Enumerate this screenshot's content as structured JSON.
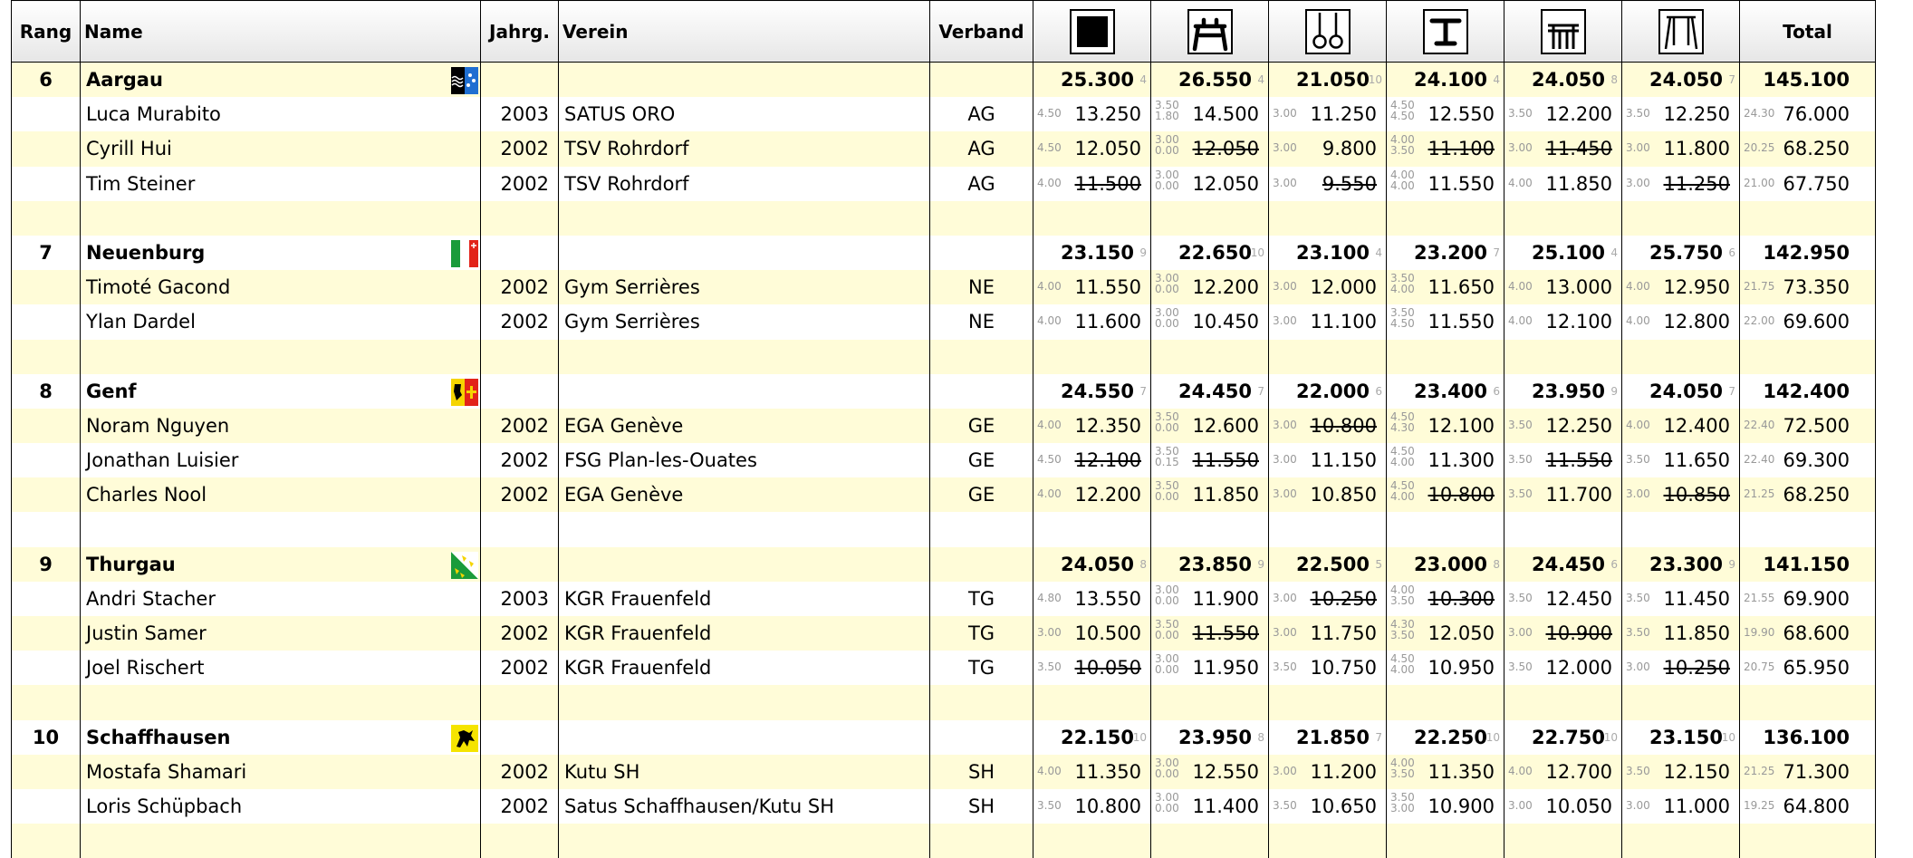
{
  "headers": {
    "rank": "Rang",
    "name": "Name",
    "year": "Jahrg.",
    "club": "Verein",
    "fed": "Verband",
    "total": "Total",
    "apparatus_icons": [
      "floor-icon",
      "pommel-horse-icon",
      "rings-icon",
      "vault-icon",
      "parallel-bars-icon",
      "high-bar-icon"
    ]
  },
  "rows": [
    {
      "kind": "team",
      "rank": "6",
      "name": "Aargau",
      "flag": "aargau-flag",
      "scores": [
        [
          "25.300",
          "4"
        ],
        [
          "26.550",
          "4"
        ],
        [
          "21.050",
          "10"
        ],
        [
          "24.100",
          "4"
        ],
        [
          "24.050",
          "8"
        ],
        [
          "24.050",
          "7"
        ]
      ],
      "total": "145.100"
    },
    {
      "kind": "athlete",
      "name": "Luca Murabito",
      "year": "2003",
      "club": "SATUS ORO",
      "fed": "AG",
      "scores": [
        {
          "d": [
            "4.50"
          ],
          "s": "13.250",
          "x": false
        },
        {
          "d": [
            "3.50",
            "1.80"
          ],
          "s": "14.500",
          "x": false
        },
        {
          "d": [
            "3.00"
          ],
          "s": "11.250",
          "x": false
        },
        {
          "d": [
            "4.50",
            "4.50"
          ],
          "s": "12.550",
          "x": false
        },
        {
          "d": [
            "3.50"
          ],
          "s": "12.200",
          "x": false
        },
        {
          "d": [
            "3.50"
          ],
          "s": "12.250",
          "x": false
        }
      ],
      "td": "24.30",
      "total": "76.000"
    },
    {
      "kind": "athlete",
      "name": "Cyrill Hui",
      "year": "2002",
      "club": "TSV Rohrdorf",
      "fed": "AG",
      "scores": [
        {
          "d": [
            "4.50"
          ],
          "s": "12.050",
          "x": false
        },
        {
          "d": [
            "3.00",
            "0.00"
          ],
          "s": "12.050",
          "x": true
        },
        {
          "d": [
            "3.00"
          ],
          "s": "9.800",
          "x": false
        },
        {
          "d": [
            "4.00",
            "3.50"
          ],
          "s": "11.100",
          "x": true
        },
        {
          "d": [
            "3.00"
          ],
          "s": "11.450",
          "x": true
        },
        {
          "d": [
            "3.00"
          ],
          "s": "11.800",
          "x": false
        }
      ],
      "td": "20.25",
      "total": "68.250"
    },
    {
      "kind": "athlete",
      "name": "Tim Steiner",
      "year": "2002",
      "club": "TSV Rohrdorf",
      "fed": "AG",
      "scores": [
        {
          "d": [
            "4.00"
          ],
          "s": "11.500",
          "x": true
        },
        {
          "d": [
            "3.00",
            "0.00"
          ],
          "s": "12.050",
          "x": false
        },
        {
          "d": [
            "3.00"
          ],
          "s": "9.550",
          "x": true
        },
        {
          "d": [
            "4.00",
            "4.00"
          ],
          "s": "11.550",
          "x": false
        },
        {
          "d": [
            "4.00"
          ],
          "s": "11.850",
          "x": false
        },
        {
          "d": [
            "3.00"
          ],
          "s": "11.250",
          "x": true
        }
      ],
      "td": "21.00",
      "total": "67.750"
    },
    {
      "kind": "spacer"
    },
    {
      "kind": "team",
      "rank": "7",
      "name": "Neuenburg",
      "flag": "neuchatel-flag",
      "scores": [
        [
          "23.150",
          "9"
        ],
        [
          "22.650",
          "10"
        ],
        [
          "23.100",
          "4"
        ],
        [
          "23.200",
          "7"
        ],
        [
          "25.100",
          "4"
        ],
        [
          "25.750",
          "6"
        ]
      ],
      "total": "142.950"
    },
    {
      "kind": "athlete",
      "name": "Timoté Gacond",
      "year": "2002",
      "club": "Gym Serrières",
      "fed": "NE",
      "scores": [
        {
          "d": [
            "4.00"
          ],
          "s": "11.550",
          "x": false
        },
        {
          "d": [
            "3.00",
            "0.00"
          ],
          "s": "12.200",
          "x": false
        },
        {
          "d": [
            "3.00"
          ],
          "s": "12.000",
          "x": false
        },
        {
          "d": [
            "3.50",
            "4.00"
          ],
          "s": "11.650",
          "x": false
        },
        {
          "d": [
            "4.00"
          ],
          "s": "13.000",
          "x": false
        },
        {
          "d": [
            "4.00"
          ],
          "s": "12.950",
          "x": false
        }
      ],
      "td": "21.75",
      "total": "73.350"
    },
    {
      "kind": "athlete",
      "name": "Ylan Dardel",
      "year": "2002",
      "club": "Gym Serrières",
      "fed": "NE",
      "scores": [
        {
          "d": [
            "4.00"
          ],
          "s": "11.600",
          "x": false
        },
        {
          "d": [
            "3.00",
            "0.00"
          ],
          "s": "10.450",
          "x": false
        },
        {
          "d": [
            "3.00"
          ],
          "s": "11.100",
          "x": false
        },
        {
          "d": [
            "3.50",
            "4.50"
          ],
          "s": "11.550",
          "x": false
        },
        {
          "d": [
            "4.00"
          ],
          "s": "12.100",
          "x": false
        },
        {
          "d": [
            "4.00"
          ],
          "s": "12.800",
          "x": false
        }
      ],
      "td": "22.00",
      "total": "69.600"
    },
    {
      "kind": "spacer"
    },
    {
      "kind": "team",
      "rank": "8",
      "name": "Genf",
      "flag": "geneva-flag",
      "scores": [
        [
          "24.550",
          "7"
        ],
        [
          "24.450",
          "7"
        ],
        [
          "22.000",
          "6"
        ],
        [
          "23.400",
          "6"
        ],
        [
          "23.950",
          "9"
        ],
        [
          "24.050",
          "7"
        ]
      ],
      "total": "142.400"
    },
    {
      "kind": "athlete",
      "name": "Noram Nguyen",
      "year": "2002",
      "club": "EGA Genève",
      "fed": "GE",
      "scores": [
        {
          "d": [
            "4.00"
          ],
          "s": "12.350",
          "x": false
        },
        {
          "d": [
            "3.50",
            "0.00"
          ],
          "s": "12.600",
          "x": false
        },
        {
          "d": [
            "3.00"
          ],
          "s": "10.800",
          "x": true
        },
        {
          "d": [
            "4.50",
            "4.30"
          ],
          "s": "12.100",
          "x": false
        },
        {
          "d": [
            "3.50"
          ],
          "s": "12.250",
          "x": false
        },
        {
          "d": [
            "4.00"
          ],
          "s": "12.400",
          "x": false
        }
      ],
      "td": "22.40",
      "total": "72.500"
    },
    {
      "kind": "athlete",
      "name": "Jonathan Luisier",
      "year": "2002",
      "club": "FSG Plan-les-Ouates",
      "fed": "GE",
      "scores": [
        {
          "d": [
            "4.50"
          ],
          "s": "12.100",
          "x": true
        },
        {
          "d": [
            "3.50",
            "0.15"
          ],
          "s": "11.550",
          "x": true
        },
        {
          "d": [
            "3.00"
          ],
          "s": "11.150",
          "x": false
        },
        {
          "d": [
            "4.50",
            "4.00"
          ],
          "s": "11.300",
          "x": false
        },
        {
          "d": [
            "3.50"
          ],
          "s": "11.550",
          "x": true
        },
        {
          "d": [
            "3.50"
          ],
          "s": "11.650",
          "x": false
        }
      ],
      "td": "22.40",
      "total": "69.300"
    },
    {
      "kind": "athlete",
      "name": "Charles Nool",
      "year": "2002",
      "club": "EGA Genève",
      "fed": "GE",
      "scores": [
        {
          "d": [
            "4.00"
          ],
          "s": "12.200",
          "x": false
        },
        {
          "d": [
            "3.50",
            "0.00"
          ],
          "s": "11.850",
          "x": false
        },
        {
          "d": [
            "3.00"
          ],
          "s": "10.850",
          "x": false
        },
        {
          "d": [
            "4.50",
            "4.00"
          ],
          "s": "10.800",
          "x": true
        },
        {
          "d": [
            "3.50"
          ],
          "s": "11.700",
          "x": false
        },
        {
          "d": [
            "3.00"
          ],
          "s": "10.850",
          "x": true
        }
      ],
      "td": "21.25",
      "total": "68.250"
    },
    {
      "kind": "spacer"
    },
    {
      "kind": "team",
      "rank": "9",
      "name": "Thurgau",
      "flag": "thurgau-flag",
      "scores": [
        [
          "24.050",
          "8"
        ],
        [
          "23.850",
          "9"
        ],
        [
          "22.500",
          "5"
        ],
        [
          "23.000",
          "8"
        ],
        [
          "24.450",
          "6"
        ],
        [
          "23.300",
          "9"
        ]
      ],
      "total": "141.150"
    },
    {
      "kind": "athlete",
      "name": "Andri Stacher",
      "year": "2003",
      "club": "KGR Frauenfeld",
      "fed": "TG",
      "scores": [
        {
          "d": [
            "4.80"
          ],
          "s": "13.550",
          "x": false
        },
        {
          "d": [
            "3.00",
            "0.00"
          ],
          "s": "11.900",
          "x": false
        },
        {
          "d": [
            "3.00"
          ],
          "s": "10.250",
          "x": true
        },
        {
          "d": [
            "4.00",
            "3.50"
          ],
          "s": "10.300",
          "x": true
        },
        {
          "d": [
            "3.50"
          ],
          "s": "12.450",
          "x": false
        },
        {
          "d": [
            "3.50"
          ],
          "s": "11.450",
          "x": false
        }
      ],
      "td": "21.55",
      "total": "69.900"
    },
    {
      "kind": "athlete",
      "name": "Justin Samer",
      "year": "2002",
      "club": "KGR Frauenfeld",
      "fed": "TG",
      "scores": [
        {
          "d": [
            "3.00"
          ],
          "s": "10.500",
          "x": false
        },
        {
          "d": [
            "3.50",
            "0.00"
          ],
          "s": "11.550",
          "x": true
        },
        {
          "d": [
            "3.00"
          ],
          "s": "11.750",
          "x": false
        },
        {
          "d": [
            "4.30",
            "3.50"
          ],
          "s": "12.050",
          "x": false
        },
        {
          "d": [
            "3.00"
          ],
          "s": "10.900",
          "x": true
        },
        {
          "d": [
            "3.50"
          ],
          "s": "11.850",
          "x": false
        }
      ],
      "td": "19.90",
      "total": "68.600"
    },
    {
      "kind": "athlete",
      "name": "Joel Rischert",
      "year": "2002",
      "club": "KGR Frauenfeld",
      "fed": "TG",
      "scores": [
        {
          "d": [
            "3.50"
          ],
          "s": "10.050",
          "x": true
        },
        {
          "d": [
            "3.00",
            "0.00"
          ],
          "s": "11.950",
          "x": false
        },
        {
          "d": [
            "3.50"
          ],
          "s": "10.750",
          "x": false
        },
        {
          "d": [
            "4.50",
            "4.00"
          ],
          "s": "10.950",
          "x": false
        },
        {
          "d": [
            "3.50"
          ],
          "s": "12.000",
          "x": false
        },
        {
          "d": [
            "3.00"
          ],
          "s": "10.250",
          "x": true
        }
      ],
      "td": "20.75",
      "total": "65.950"
    },
    {
      "kind": "spacer"
    },
    {
      "kind": "team",
      "rank": "10",
      "name": "Schaffhausen",
      "flag": "schaffhausen-flag",
      "scores": [
        [
          "22.150",
          "10"
        ],
        [
          "23.950",
          "8"
        ],
        [
          "21.850",
          "7"
        ],
        [
          "22.250",
          "10"
        ],
        [
          "22.750",
          "10"
        ],
        [
          "23.150",
          "10"
        ]
      ],
      "total": "136.100"
    },
    {
      "kind": "athlete",
      "name": "Mostafa Shamari",
      "year": "2002",
      "club": "Kutu SH",
      "fed": "SH",
      "scores": [
        {
          "d": [
            "4.00"
          ],
          "s": "11.350",
          "x": false
        },
        {
          "d": [
            "3.00",
            "0.00"
          ],
          "s": "12.550",
          "x": false
        },
        {
          "d": [
            "3.00"
          ],
          "s": "11.200",
          "x": false
        },
        {
          "d": [
            "4.00",
            "3.50"
          ],
          "s": "11.350",
          "x": false
        },
        {
          "d": [
            "4.00"
          ],
          "s": "12.700",
          "x": false
        },
        {
          "d": [
            "3.50"
          ],
          "s": "12.150",
          "x": false
        }
      ],
      "td": "21.25",
      "total": "71.300"
    },
    {
      "kind": "athlete",
      "name": "Loris Schüpbach",
      "year": "2002",
      "club": "Satus Schaffhausen/Kutu SH",
      "fed": "SH",
      "scores": [
        {
          "d": [
            "3.50"
          ],
          "s": "10.800",
          "x": false
        },
        {
          "d": [
            "3.00",
            "0.00"
          ],
          "s": "11.400",
          "x": false
        },
        {
          "d": [
            "3.50"
          ],
          "s": "10.650",
          "x": false
        },
        {
          "d": [
            "3.50",
            "3.00"
          ],
          "s": "10.900",
          "x": false
        },
        {
          "d": [
            "3.00"
          ],
          "s": "10.050",
          "x": false
        },
        {
          "d": [
            "3.00"
          ],
          "s": "11.000",
          "x": false
        }
      ],
      "td": "19.25",
      "total": "64.800"
    },
    {
      "kind": "spacer"
    }
  ]
}
